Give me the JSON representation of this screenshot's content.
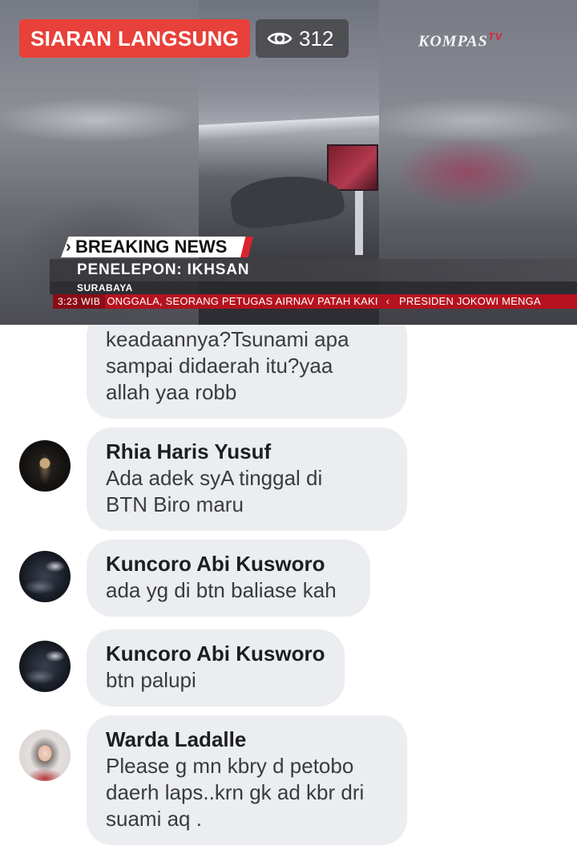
{
  "video": {
    "live_label": "SIARAN LANGSUNG",
    "viewer_count": "312",
    "channel_logo_main": "KOMPAS",
    "channel_logo_sub": "TV",
    "breaking_label": "BREAKING NEWS",
    "caller": "PENELEPON: IKHSAN",
    "city": "SURABAYA",
    "ticker_time": "3:23  WIB",
    "ticker_text_1": "ONGGALA, SEORANG PETUGAS AIRNAV PATAH KAKI",
    "ticker_text_2": "PRESIDEN JOKOWI MENGA",
    "colors": {
      "live_red": "#e8403a",
      "ticker_red": "#b5121f"
    }
  },
  "comments": [
    {
      "name": "",
      "message": "keadaannya?Tsunami apa\nsampai didaerah itu?yaa\nallah yaa robb",
      "avatar": "none"
    },
    {
      "name": "Rhia Haris Yusuf",
      "message": "Ada adek syA  tinggal di\nBTN Biro maru",
      "avatar": "dark-photo"
    },
    {
      "name": "Kuncoro Abi Kusworo",
      "message": "ada yg di btn baliase kah",
      "avatar": "night-photo"
    },
    {
      "name": "Kuncoro Abi Kusworo",
      "message": "btn palupi",
      "avatar": "night-photo"
    },
    {
      "name": "Warda Ladalle",
      "message": "Please g mn kbry d petobo\ndaerh laps..krn gk ad kbr dri\nsuami aq .",
      "avatar": "person-photo"
    }
  ],
  "comment_bubble_color": "#ebedf0"
}
